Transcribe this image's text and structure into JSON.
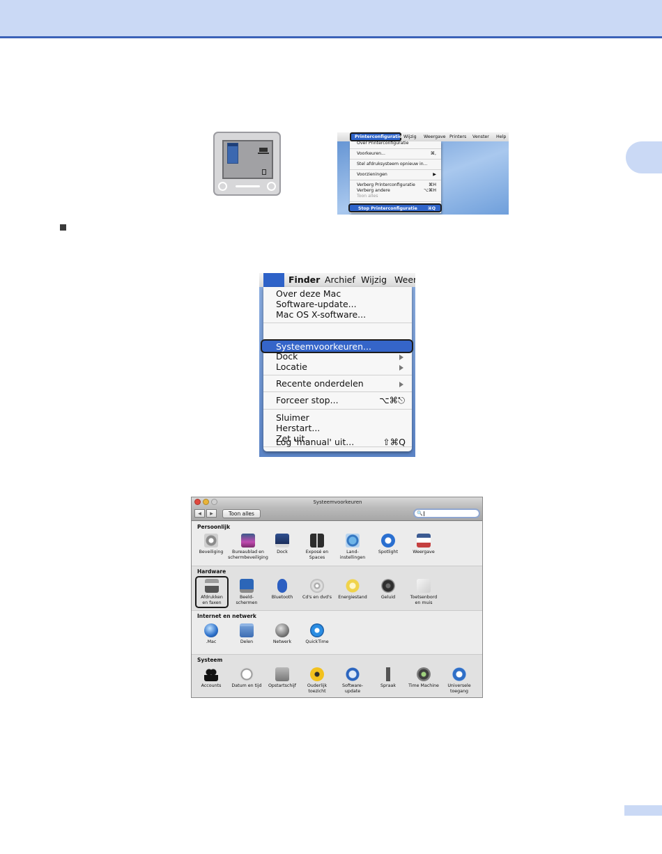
{
  "pc_menu": {
    "apple_glyph": "",
    "app_title": "Printerconfiguratie",
    "menubar": [
      "Wijzig",
      "Weergave",
      "Printers",
      "Venster",
      "Help"
    ],
    "items": [
      {
        "label": "Over Printerconfiguratie",
        "shortcut": ""
      },
      {
        "label": "Voorkeuren...",
        "shortcut": "⌘,"
      },
      {
        "label": "Stel afdruksysteem opnieuw in...",
        "shortcut": ""
      },
      {
        "label": "Voorzieningen",
        "shortcut": "▶"
      },
      {
        "label": "Verberg Printerconfiguratie",
        "shortcut": "⌘H"
      },
      {
        "label": "Verberg andere",
        "shortcut": "⌥⌘H"
      },
      {
        "label": "Toon alles",
        "shortcut": ""
      }
    ],
    "quit": {
      "label": "Stop Printerconfiguratie",
      "shortcut": "⌘Q"
    }
  },
  "apple_menu": {
    "apple_glyph": "",
    "menubar": [
      "Finder",
      "Archief",
      "Wijzig",
      "Weerg"
    ],
    "items": {
      "about": "Over deze Mac",
      "software_update": "Software-update...",
      "osx_software": "Mac OS X-software...",
      "system_prefs": "Systeemvoorkeuren...",
      "dock": "Dock",
      "location": "Locatie",
      "recent": "Recente onderdelen",
      "force_quit": "Forceer stop...",
      "force_quit_shortcut": "⌥⌘⎋",
      "sleep": "Sluimer",
      "restart": "Herstart...",
      "shutdown": "Zet uit...",
      "logout": "Log 'manual' uit...",
      "logout_shortcut": "⇧⌘Q"
    }
  },
  "syspref": {
    "title": "Systeemvoorkeuren",
    "back_glyph": "◀",
    "forward_glyph": "▶",
    "show_all": "Toon alles",
    "search_glyph": "🔍",
    "sections": {
      "personal": {
        "label": "Persoonlijk",
        "items": {
          "security": "Beveiliging",
          "desktop": "Bureaublad en\nschermbeveiliging",
          "dock": "Dock",
          "expose": "Exposé en\nSpaces",
          "international": "Land-\ninstellingen",
          "spotlight": "Spotlight",
          "appearance": "Weergave"
        }
      },
      "hardware": {
        "label": "Hardware",
        "items": {
          "print_fax": "Afdrukken\nen faxen",
          "displays": "Beeld-\nschermen",
          "bluetooth": "Bluetooth",
          "cds": "Cd's en dvd's",
          "energy": "Energiestand",
          "sound": "Geluid",
          "keyboard": "Toetsenbord\nen muis"
        }
      },
      "internet": {
        "label": "Internet en netwerk",
        "items": {
          "mac": ".Mac",
          "sharing": "Delen",
          "network": "Netwerk",
          "quicktime": "QuickTime"
        }
      },
      "system": {
        "label": "Systeem",
        "items": {
          "accounts": "Accounts",
          "datetime": "Datum en tijd",
          "startup": "Opstartschijf",
          "parental": "Ouderlijk\ntoezicht",
          "swupdate": "Software-\nupdate",
          "speech": "Spraak",
          "timemachine": "Time Machine",
          "universal": "Universele\ntoegang"
        }
      }
    }
  },
  "colors": {
    "header_band": "#cad9f5",
    "header_rule": "#3b62b8",
    "menu_highlight": "#2f64c9"
  }
}
